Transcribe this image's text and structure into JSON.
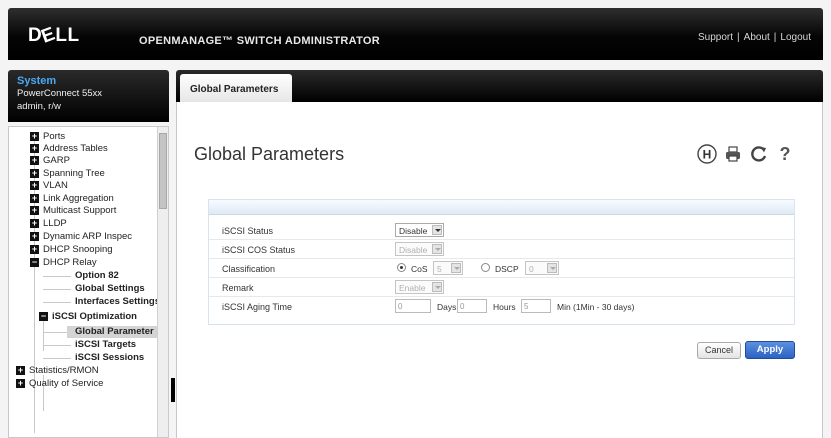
{
  "header": {
    "logo": "DELL",
    "product_title": "OPENMANAGE™ SWITCH ADMINISTRATOR",
    "links": [
      "Support",
      "About",
      "Logout"
    ],
    "link_separator": "|"
  },
  "system": {
    "title": "System",
    "model": "PowerConnect 55xx",
    "user": "admin, r/w"
  },
  "nav": {
    "items": [
      {
        "label": "Ports",
        "expander": "+"
      },
      {
        "label": "Address Tables",
        "expander": "+"
      },
      {
        "label": "GARP",
        "expander": "+"
      },
      {
        "label": "Spanning Tree",
        "expander": "+"
      },
      {
        "label": "VLAN",
        "expander": "+"
      },
      {
        "label": "Link Aggregation",
        "expander": "+"
      },
      {
        "label": "Multicast Support",
        "expander": "+"
      },
      {
        "label": "LLDP",
        "expander": "+"
      },
      {
        "label": "Dynamic ARP Inspec",
        "expander": "+"
      },
      {
        "label": "DHCP Snooping",
        "expander": "+"
      },
      {
        "label": "DHCP Relay",
        "expander": "−"
      },
      {
        "label": "Option 82"
      },
      {
        "label": "Global Settings"
      },
      {
        "label": "Interfaces Settings"
      },
      {
        "label": "iSCSI Optimization",
        "expander": "−"
      },
      {
        "label": "Global Parameter"
      },
      {
        "label": "iSCSI Targets"
      },
      {
        "label": "iSCSI Sessions"
      },
      {
        "label": "Statistics/RMON",
        "expander": "+"
      },
      {
        "label": "Quality of Service",
        "expander": "+"
      }
    ]
  },
  "tabs": [
    {
      "label": "Global Parameters"
    }
  ],
  "page": {
    "title": "Global Parameters",
    "icons": {
      "save": "H",
      "help": "?"
    }
  },
  "form": {
    "status": {
      "label": "iSCSI Status",
      "value": "Disable"
    },
    "cos_status": {
      "label": "iSCSI COS Status",
      "value": "Disable"
    },
    "classification": {
      "label": "Classification",
      "cos_label": "CoS",
      "cos_value": "5",
      "dscp_label": "DSCP",
      "dscp_value": "0"
    },
    "remark": {
      "label": "Remark",
      "value": "Enable"
    },
    "aging": {
      "label": "iSCSI Aging Time",
      "days_value": "0",
      "days_label": "Days",
      "hours_value": "0",
      "hours_label": "Hours",
      "min_value": "5",
      "min_label": "Min (1Min - 30 days)"
    }
  },
  "buttons": {
    "cancel": "Cancel",
    "apply": "Apply"
  }
}
